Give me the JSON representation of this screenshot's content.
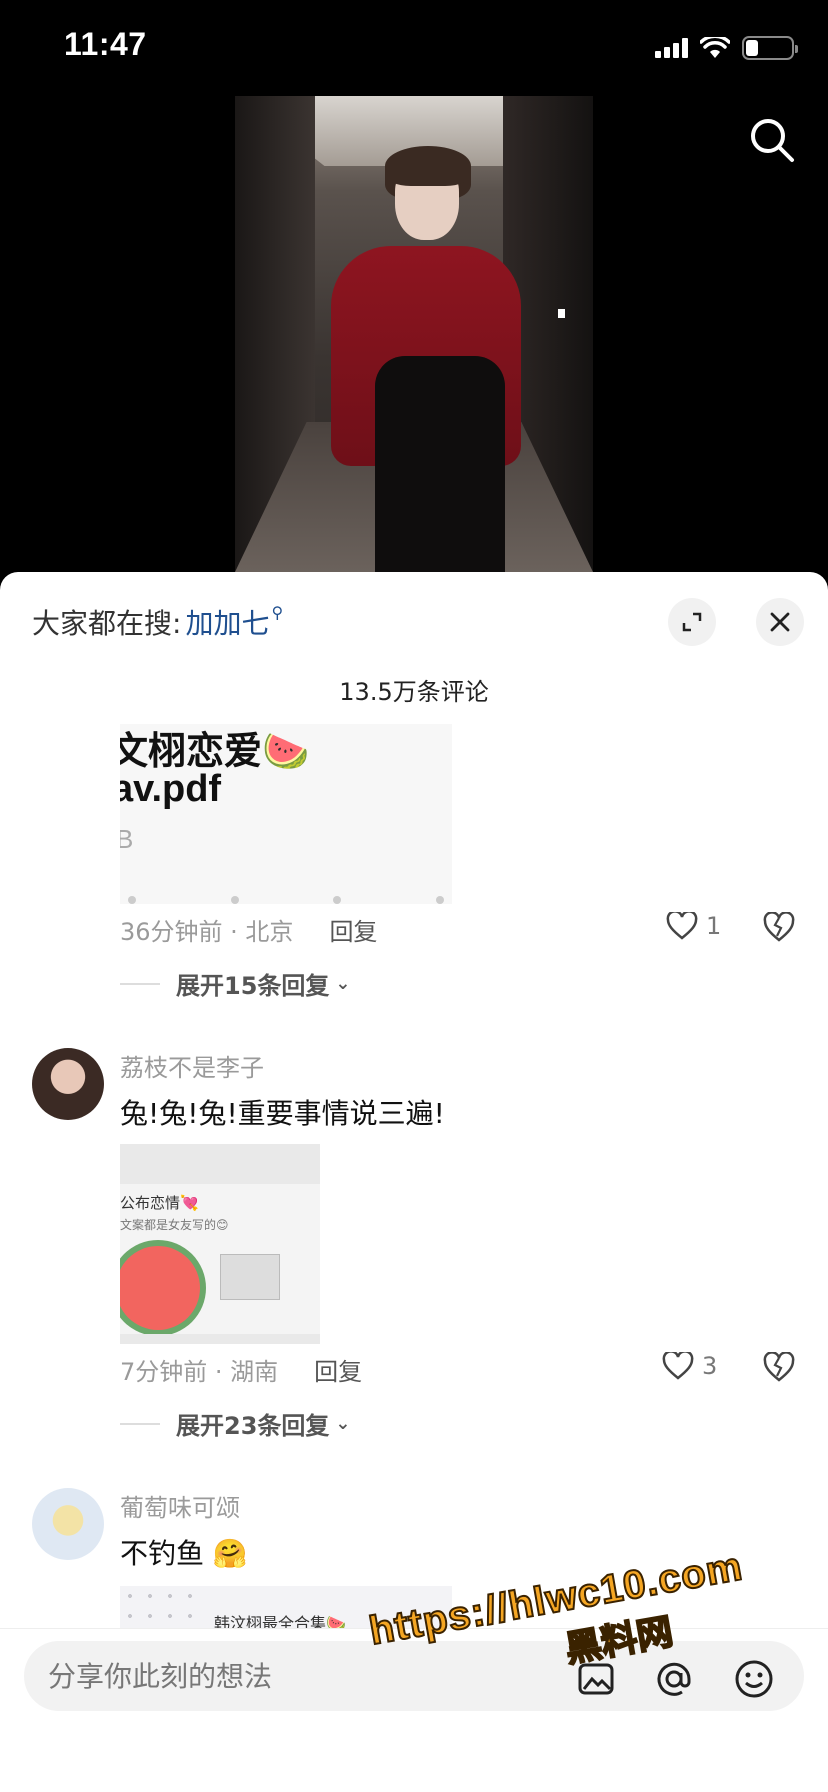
{
  "status_bar": {
    "time": "11:47"
  },
  "panel": {
    "hot_search_label": "大家都在搜:",
    "hot_search_keyword": "加加七",
    "comment_count": "13.5万条评论"
  },
  "comments": [
    {
      "card_line1": "文栩恋爱🍉",
      "card_line2": "av.pdf",
      "card_line3": "B",
      "meta": "36分钟前 · 北京",
      "reply": "回复",
      "likes": "1",
      "expand": "展开15条回复"
    },
    {
      "username": "荔枝不是李子",
      "text": "兔!兔!兔!重要事情说三遍!",
      "card_line1": "公布恋情💘",
      "card_line2": "文案都是女友写的😊",
      "meta": "7分钟前 · 湖南",
      "reply": "回复",
      "likes": "3",
      "expand": "展开23条回复"
    },
    {
      "username": "葡萄味可颂",
      "text": "不钓鱼 🤗",
      "card_label": "韩汶栩最全合集🍉"
    }
  ],
  "input": {
    "placeholder": "分享你此刻的想法"
  },
  "watermark": {
    "url": "https://hlwc10.com",
    "name": "黑料网"
  },
  "icons": [
    "search-icon",
    "expand-icon",
    "close-icon",
    "heart-icon",
    "broken-heart-icon",
    "chevron-down-icon",
    "image-icon",
    "at-icon",
    "emoji-icon"
  ]
}
